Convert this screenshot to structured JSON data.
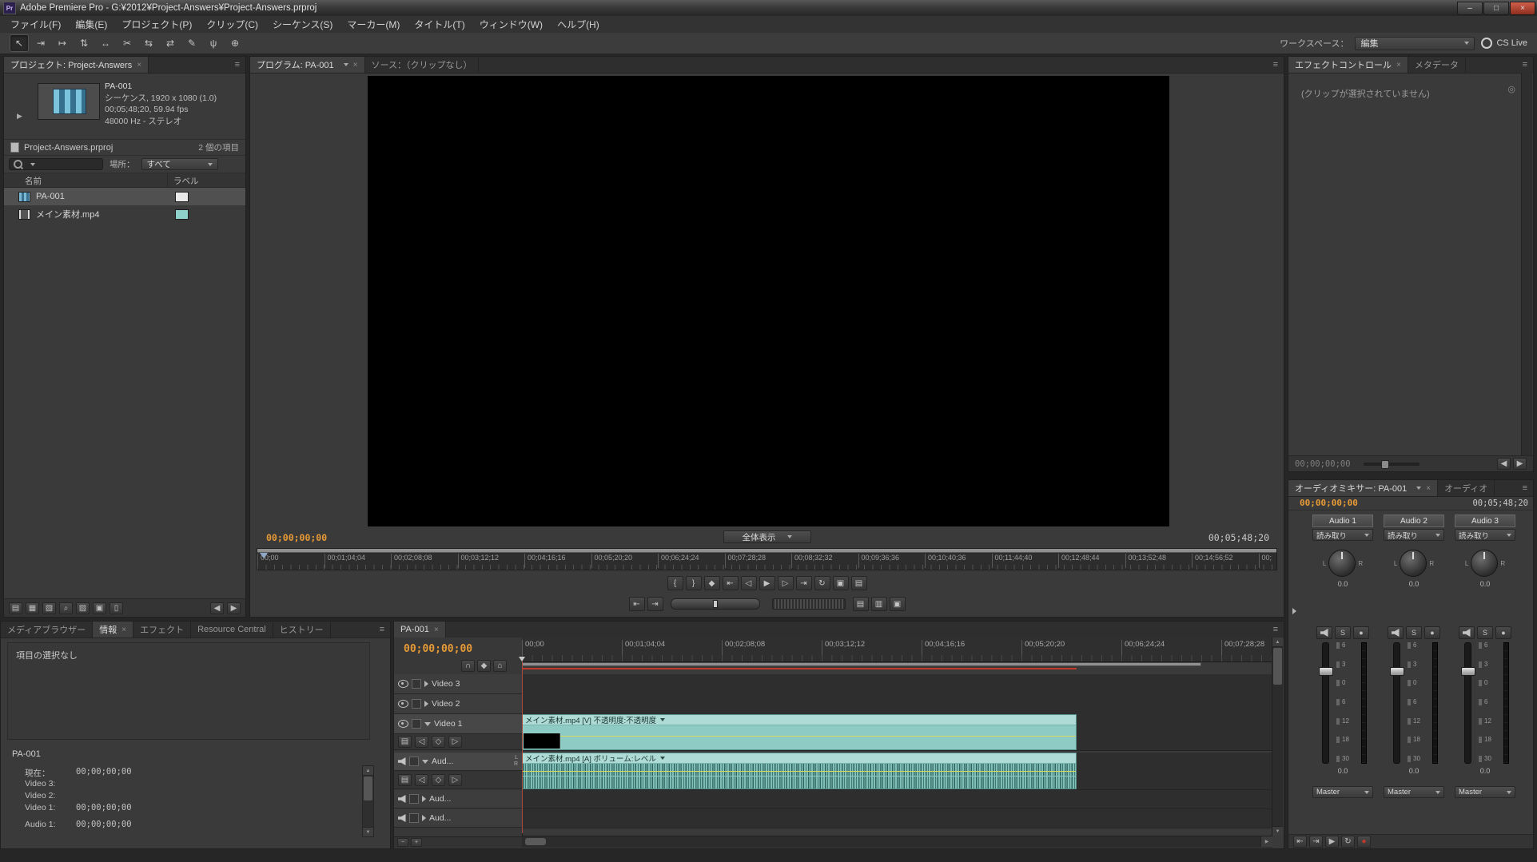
{
  "colors": {
    "accent_orange": "#e79a35",
    "clip_teal": "#8ecbc5",
    "label_teal": "#8fd0ca",
    "label_white": "#e9e9e9",
    "record_red": "#c0392b"
  },
  "ui": {
    "close": "×",
    "panel_menu": "≡"
  },
  "titlebar": {
    "app_icon": "Pr",
    "title": "Adobe Premiere Pro - G:¥2012¥Project-Answers¥Project-Answers.prproj",
    "minimize": "–",
    "maximize": "□",
    "close": "×"
  },
  "menubar": {
    "items": [
      {
        "name": "menu-file",
        "label": "ファイル(F)"
      },
      {
        "name": "menu-edit",
        "label": "編集(E)"
      },
      {
        "name": "menu-project",
        "label": "プロジェクト(P)"
      },
      {
        "name": "menu-clip",
        "label": "クリップ(C)"
      },
      {
        "name": "menu-sequence",
        "label": "シーケンス(S)"
      },
      {
        "name": "menu-marker",
        "label": "マーカー(M)"
      },
      {
        "name": "menu-title",
        "label": "タイトル(T)"
      },
      {
        "name": "menu-window",
        "label": "ウィンドウ(W)"
      },
      {
        "name": "menu-help",
        "label": "ヘルプ(H)"
      }
    ]
  },
  "toolbar": {
    "tools": [
      {
        "name": "selection-tool",
        "glyph": "↖"
      },
      {
        "name": "track-select-tool",
        "glyph": "⇥"
      },
      {
        "name": "ripple-edit-tool",
        "glyph": "↦"
      },
      {
        "name": "rolling-edit-tool",
        "glyph": "⇅"
      },
      {
        "name": "rate-stretch-tool",
        "glyph": "↔"
      },
      {
        "name": "razor-tool",
        "glyph": "✂"
      },
      {
        "name": "slip-tool",
        "glyph": "⇆"
      },
      {
        "name": "slide-tool",
        "glyph": "⇄"
      },
      {
        "name": "pen-tool",
        "glyph": "✎"
      },
      {
        "name": "hand-tool",
        "glyph": "ψ"
      },
      {
        "name": "zoom-tool",
        "glyph": "⊕"
      }
    ],
    "workspace_label": "ワークスペース：",
    "workspace_value": "編集",
    "cs_live_label": "CS Live"
  },
  "project": {
    "tab": "プロジェクト: Project-Answers",
    "preview_name": "PA-001",
    "preview_line1": "シーケンス, 1920 x 1080 (1.0)",
    "preview_line2": "00;05;48;20, 59.94 fps",
    "preview_line3": "48000 Hz - ステレオ",
    "file_name": "Project-Answers.prproj",
    "item_count": "2 個の項目",
    "location_label": "場所：",
    "location_value": "すべて",
    "col_name": "名前",
    "col_label": "ラベル",
    "items": [
      {
        "name": "PA-001",
        "type": "sequence"
      },
      {
        "name": "メイン素材.mp4",
        "type": "movie"
      }
    ],
    "footer_icons": [
      {
        "name": "list-view-button",
        "glyph": "▤"
      },
      {
        "name": "icon-view-button",
        "glyph": "▦"
      },
      {
        "name": "automate-to-sequence-button",
        "glyph": "▧"
      },
      {
        "name": "find-button",
        "glyph": "⌕"
      },
      {
        "name": "new-bin-button",
        "glyph": "▨"
      },
      {
        "name": "new-item-button",
        "glyph": "▣"
      },
      {
        "name": "clear-button",
        "glyph": "▯"
      },
      {
        "name": "scroll-left-button",
        "glyph": "◀"
      },
      {
        "name": "scroll-right-button",
        "glyph": "▶"
      }
    ]
  },
  "program": {
    "tab": "プログラム: PA-001",
    "source_tab": "ソース：（クリップなし）",
    "current_time": "00;00;00;00",
    "fit_label": "全体表示",
    "duration": "00;05;48;20",
    "ruler": [
      "00;00",
      "00;01;04;04",
      "00;02;08;08",
      "00;03;12;12",
      "00;04;16;16",
      "00;05;20;20",
      "00;06;24;24",
      "00;07;28;28",
      "00;08;32;32",
      "00;09;36;36",
      "00;10;40;36",
      "00;11;44;40",
      "00;12;48;44",
      "00;13;52;48",
      "00;14;56;52",
      "00;"
    ],
    "transport_row1": [
      {
        "name": "set-in-button",
        "glyph": "{"
      },
      {
        "name": "set-out-button",
        "glyph": "}"
      },
      {
        "name": "add-marker-button",
        "glyph": "◆"
      },
      {
        "name": "go-to-in-button",
        "glyph": "⇤"
      },
      {
        "name": "step-back-button",
        "glyph": "◁"
      },
      {
        "name": "play-button",
        "glyph": "▶"
      },
      {
        "name": "step-forward-button",
        "glyph": "▷"
      },
      {
        "name": "go-to-out-button",
        "glyph": "⇥"
      },
      {
        "name": "loop-button",
        "glyph": "↻"
      },
      {
        "name": "safe-margins-button",
        "glyph": "▣"
      },
      {
        "name": "output-button",
        "glyph": "▤"
      }
    ],
    "transport_row2_left": [
      {
        "name": "prev-edit-button",
        "glyph": "⇤"
      },
      {
        "name": "next-edit-button",
        "glyph": "⇥"
      }
    ],
    "transport_row2_right": [
      {
        "name": "lift-button",
        "glyph": "▤"
      },
      {
        "name": "extract-button",
        "glyph": "▥"
      },
      {
        "name": "export-frame-button",
        "glyph": "▣"
      }
    ]
  },
  "effects": {
    "tab": "エフェクトコントロール",
    "tab_metadata": "メタデータ",
    "message": "(クリップが選択されていません)",
    "toggle_glyph": "◎",
    "footer_time": "00;00;00;00",
    "footer_icons": [
      {
        "name": "prev-keyframe-button",
        "glyph": "◀"
      },
      {
        "name": "next-keyframe-button",
        "glyph": "▶"
      }
    ]
  },
  "mixer": {
    "tab": "オーディオミキサー: PA-001",
    "tab_audio": "オーディオ",
    "current_time": "00;00;00;00",
    "duration": "00;05;48;20",
    "pan_left": "L",
    "pan_right": "R",
    "solo_glyph": "S",
    "record_glyph": "●",
    "fader_scale": [
      "6",
      "3",
      "0",
      "6",
      "12",
      "18",
      "30"
    ],
    "channels": [
      {
        "name": "Audio 1",
        "mode": "読み取り",
        "pan": "0.0",
        "level": "0.0",
        "output": "Master"
      },
      {
        "name": "Audio 2",
        "mode": "読み取り",
        "pan": "0.0",
        "level": "0.0",
        "output": "Master"
      },
      {
        "name": "Audio 3",
        "mode": "読み取り",
        "pan": "0.0",
        "level": "0.0",
        "output": "Master"
      }
    ],
    "transport": [
      {
        "name": "go-to-in-button",
        "glyph": "⇤"
      },
      {
        "name": "go-to-out-button",
        "glyph": "⇥"
      },
      {
        "name": "play-button",
        "glyph": "▶"
      },
      {
        "name": "loop-button",
        "glyph": "↻"
      },
      {
        "name": "record-button",
        "glyph": "●"
      }
    ]
  },
  "info": {
    "tabs": [
      "メディアブラウザー",
      "情報",
      "エフェクト",
      "Resource Central",
      "ヒストリー"
    ],
    "no_selection": "項目の選択なし",
    "sequence_name": "PA-001",
    "rows": [
      {
        "label": "現在：",
        "value": "00;00;00;00"
      },
      {
        "label": "Video 3:",
        "value": ""
      },
      {
        "label": "Video 2:",
        "value": ""
      },
      {
        "label": "Video 1:",
        "value": "00;00;00;00"
      },
      {
        "label": "Audio 1:",
        "value": "00;00;00;00"
      }
    ]
  },
  "timeline": {
    "tab": "PA-001",
    "current_time": "00;00;00;00",
    "ruler": [
      "00;00",
      "00;01;04;04",
      "00;02;08;08",
      "00;03;12;12",
      "00;04;16;16",
      "00;05;20;20",
      "00;06;24;24",
      "00;07;28;28"
    ],
    "left_icons": [
      {
        "name": "snap-toggle",
        "glyph": "∩"
      },
      {
        "name": "set-marker-button",
        "glyph": "◆"
      },
      {
        "name": "set-encore-chapter-button",
        "glyph": "⌂"
      }
    ],
    "subicons": {
      "display": "▤",
      "prev": "◁",
      "add": "◇",
      "next": "▷"
    },
    "video_tracks": [
      {
        "name": "Video 3"
      },
      {
        "name": "Video 2"
      },
      {
        "name": "Video 1"
      }
    ],
    "audio_tracks": [
      {
        "name": "Aud..."
      },
      {
        "name": "Aud..."
      },
      {
        "name": "Aud..."
      }
    ],
    "channel_left": "L",
    "channel_right": "R",
    "video_clip_label": "メイン素材.mp4 [V] 不透明度:不透明度",
    "audio_clip_label": "メイン素材.mp4 [A] ボリューム:レベル"
  }
}
